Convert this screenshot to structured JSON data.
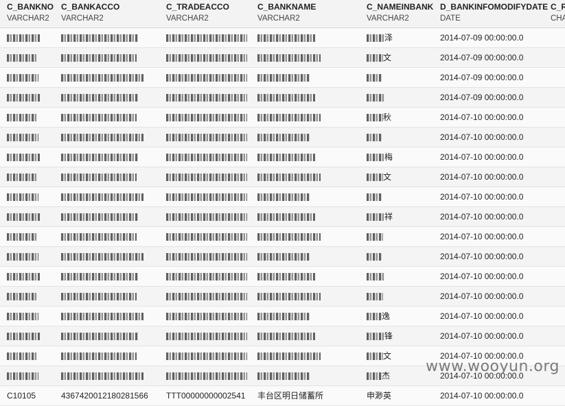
{
  "columns": [
    {
      "name": "C_BANKNO",
      "type": "VARCHAR2"
    },
    {
      "name": "C_BANKACCO",
      "type": "VARCHAR2"
    },
    {
      "name": "C_TRADEACCO",
      "type": "VARCHAR2"
    },
    {
      "name": "C_BANKNAME",
      "type": "VARCHAR2"
    },
    {
      "name": "C_NAMEINBANK",
      "type": "VARCHAR2"
    },
    {
      "name": "D_BANKINFOMODIFYDATE",
      "type": "DATE"
    },
    {
      "name": "C_R",
      "type": "CHA"
    }
  ],
  "rows": [
    {
      "date": "2014-07-09 00:00:00.0",
      "nameSuffix": "泽"
    },
    {
      "date": "2014-07-09 00:00:00.0",
      "nameSuffix": "文"
    },
    {
      "date": "2014-07-09 00:00:00.0",
      "nameSuffix": ""
    },
    {
      "date": "2014-07-09 00:00:00.0",
      "nameSuffix": ""
    },
    {
      "date": "2014-07-10 00:00:00.0",
      "nameSuffix": "秋"
    },
    {
      "date": "2014-07-10 00:00:00.0",
      "nameSuffix": ""
    },
    {
      "date": "2014-07-10 00:00:00.0",
      "nameSuffix": "梅"
    },
    {
      "date": "2014-07-10 00:00:00.0",
      "nameSuffix": "文"
    },
    {
      "date": "2014-07-10 00:00:00.0",
      "nameSuffix": ""
    },
    {
      "date": "2014-07-10 00:00:00.0",
      "nameSuffix": "祥"
    },
    {
      "date": "2014-07-10 00:00:00.0",
      "nameSuffix": ""
    },
    {
      "date": "2014-07-10 00:00:00.0",
      "nameSuffix": ""
    },
    {
      "date": "2014-07-10 00:00:00.0",
      "nameSuffix": ""
    },
    {
      "date": "2014-07-10 00:00:00.0",
      "nameSuffix": ""
    },
    {
      "date": "2014-07-10 00:00:00.0",
      "nameSuffix": "逸"
    },
    {
      "date": "2014-07-10 00:00:00.0",
      "nameSuffix": "锋"
    },
    {
      "date": "2014-07-10 00:00:00.0",
      "nameSuffix": "文"
    },
    {
      "date": "2014-07-10 00:00:00.0",
      "nameSuffix": "杰"
    }
  ],
  "lastRow": {
    "bankno": "C10105",
    "bankacco": "4367420012180281566",
    "tradeacco": "TTT00000000002541",
    "bankname": "丰台区明日储蓄所",
    "nameinbank": "申渺英",
    "date": "2014-07-10 00:00:00.0"
  },
  "watermark": "www.wooyun.org"
}
